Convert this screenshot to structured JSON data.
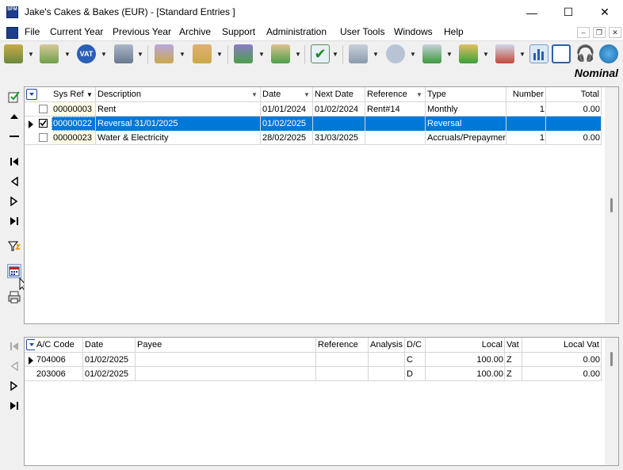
{
  "window": {
    "title": "Jake's Cakes & Bakes (EUR) - [Standard Entries ]",
    "minimize": "—",
    "maximize": "☐",
    "close": "✕"
  },
  "menu": [
    "File",
    "Current Year",
    "Previous Year",
    "Archive",
    "Support",
    "Administration",
    "User Tools",
    "Windows",
    "Help"
  ],
  "mdi": {
    "minimize": "–",
    "restore": "❐",
    "close": "✕"
  },
  "toolbar": {
    "module_label": "Nominal",
    "vat_label": "VAT",
    "icons": [
      "layers-icon",
      "ledger-icon",
      "vat-icon",
      "bank-icon",
      "sales-icon",
      "purchases-icon",
      "payroll-icon",
      "journal-icon",
      "check-icon",
      "stack-icon",
      "orders-icon",
      "stock-icon",
      "users-icon",
      "ship-icon",
      "chart-icon",
      "window-icon",
      "headset-icon",
      "globe-icon"
    ]
  },
  "upper_grid": {
    "columns": [
      "Sys Ref",
      "Description",
      "Date",
      "Next Date",
      "Reference",
      "Type",
      "Number",
      "Total"
    ],
    "rows": [
      {
        "checked": false,
        "selected": false,
        "sys_ref": "00000003",
        "description": "Rent",
        "date": "01/01/2024",
        "next_date": "01/02/2024",
        "reference": "Rent#14",
        "type": "Monthly",
        "number": "1",
        "total": "0.00"
      },
      {
        "checked": true,
        "selected": true,
        "sys_ref": "00000022",
        "description": "Reversal 31/01/2025",
        "date": "01/02/2025",
        "next_date": "",
        "reference": "",
        "type": "Reversal",
        "number": "",
        "total": ""
      },
      {
        "checked": false,
        "selected": false,
        "sys_ref": "00000023",
        "description": "Water & Electricity",
        "date": "28/02/2025",
        "next_date": "31/03/2025",
        "reference": "",
        "type": "Accruals/Prepaymen",
        "number": "1",
        "total": "0.00"
      }
    ]
  },
  "lower_grid": {
    "columns": [
      "A/C Code",
      "Date",
      "Payee",
      "Reference",
      "Analysis",
      "D/C",
      "Local",
      "Vat",
      "Local Vat"
    ],
    "rows": [
      {
        "ac_code": "704006",
        "date": "01/02/2025",
        "payee": "",
        "reference": "",
        "analysis": "",
        "dc": "C",
        "local": "100.00",
        "vat": "Z",
        "local_vat": "0.00"
      },
      {
        "ac_code": "203006",
        "date": "01/02/2025",
        "payee": "",
        "reference": "",
        "analysis": "",
        "dc": "D",
        "local": "100.00",
        "vat": "Z",
        "local_vat": "0.00"
      }
    ]
  },
  "colors": {
    "selection": "#0078d7",
    "sysref_cell": "#fffbe6"
  }
}
